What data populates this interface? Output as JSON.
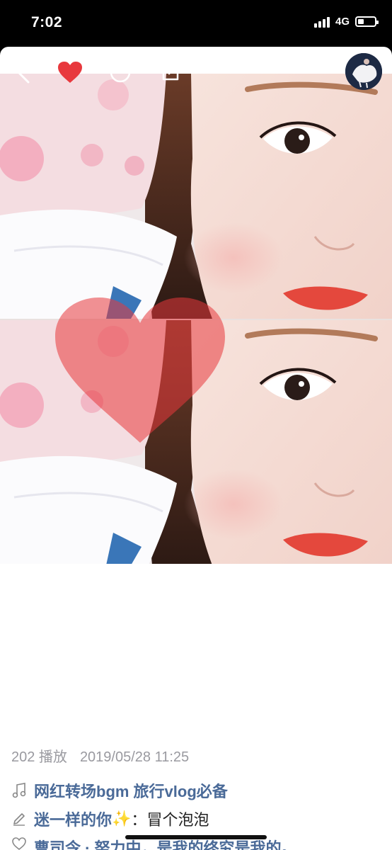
{
  "status_bar": {
    "time": "7:02",
    "network": "4G",
    "battery_level": 0.35
  },
  "nav": {
    "back_icon": "chevron-left-icon",
    "like_icon": "heart-icon",
    "like_color": "#e8383d",
    "comment_icon": "circle-icon",
    "share_icon": "share-icon"
  },
  "stats": {
    "plays": "202 播放",
    "timestamp": "2019/05/28 11:25"
  },
  "music": {
    "icon": "music-note-icon",
    "title": "网红转场bgm 旅行vlog必备"
  },
  "comment": {
    "icon": "pencil-icon",
    "author": "迷一样的你",
    "emoji": "✨",
    "separator": "：",
    "text": "冒个泡泡"
  },
  "like_row": {
    "icon": "heart-outline-icon",
    "text": "曹司令 · 努力中，是我的终究是我的。"
  },
  "colors": {
    "accent_link": "#4a6a98",
    "meta_gray": "#9a9aa0",
    "heart_red": "#e8383d"
  }
}
